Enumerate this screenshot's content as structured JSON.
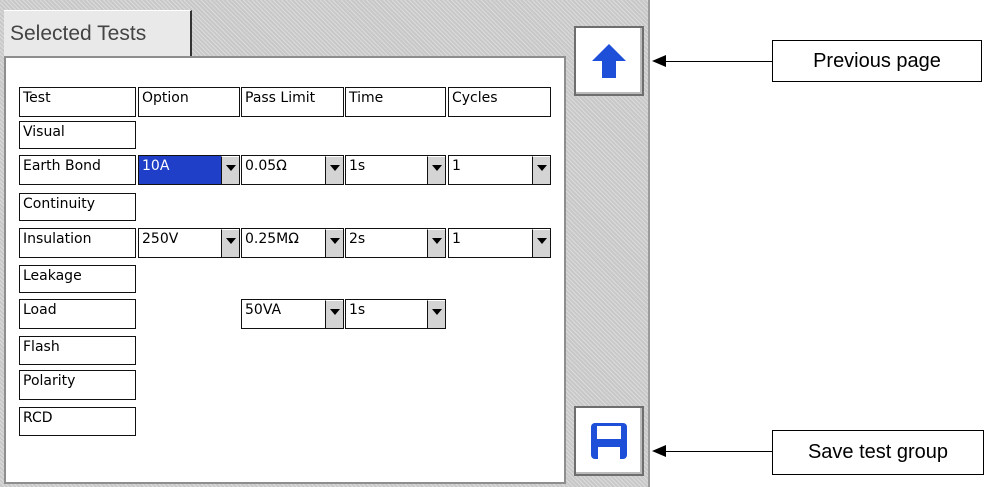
{
  "tab": {
    "label": "Selected Tests"
  },
  "columns": [
    "Test",
    "Option",
    "Pass Limit",
    "Time",
    "Cycles"
  ],
  "tests": [
    "Visual",
    "Earth Bond",
    "Continuity",
    "Insulation",
    "Leakage",
    "Load",
    "Flash",
    "Polarity",
    "RCD"
  ],
  "dropdowns": {
    "earth_bond": {
      "option": "10A",
      "pass_limit": "0.05Ω",
      "time": "1s",
      "cycles": "1"
    },
    "insulation": {
      "option": "250V",
      "pass_limit": "0.25MΩ",
      "time": "2s",
      "cycles": "1"
    },
    "load": {
      "pass_limit": "50VA",
      "time": "1s"
    }
  },
  "buttons": {
    "previous_icon": "arrow-up-icon",
    "save_icon": "floppy-disk-icon"
  },
  "callouts": {
    "previous": "Previous page",
    "save": "Save test group"
  },
  "colors": {
    "selected": "#1f3fc8",
    "button_icon": "#1e4fd8"
  }
}
